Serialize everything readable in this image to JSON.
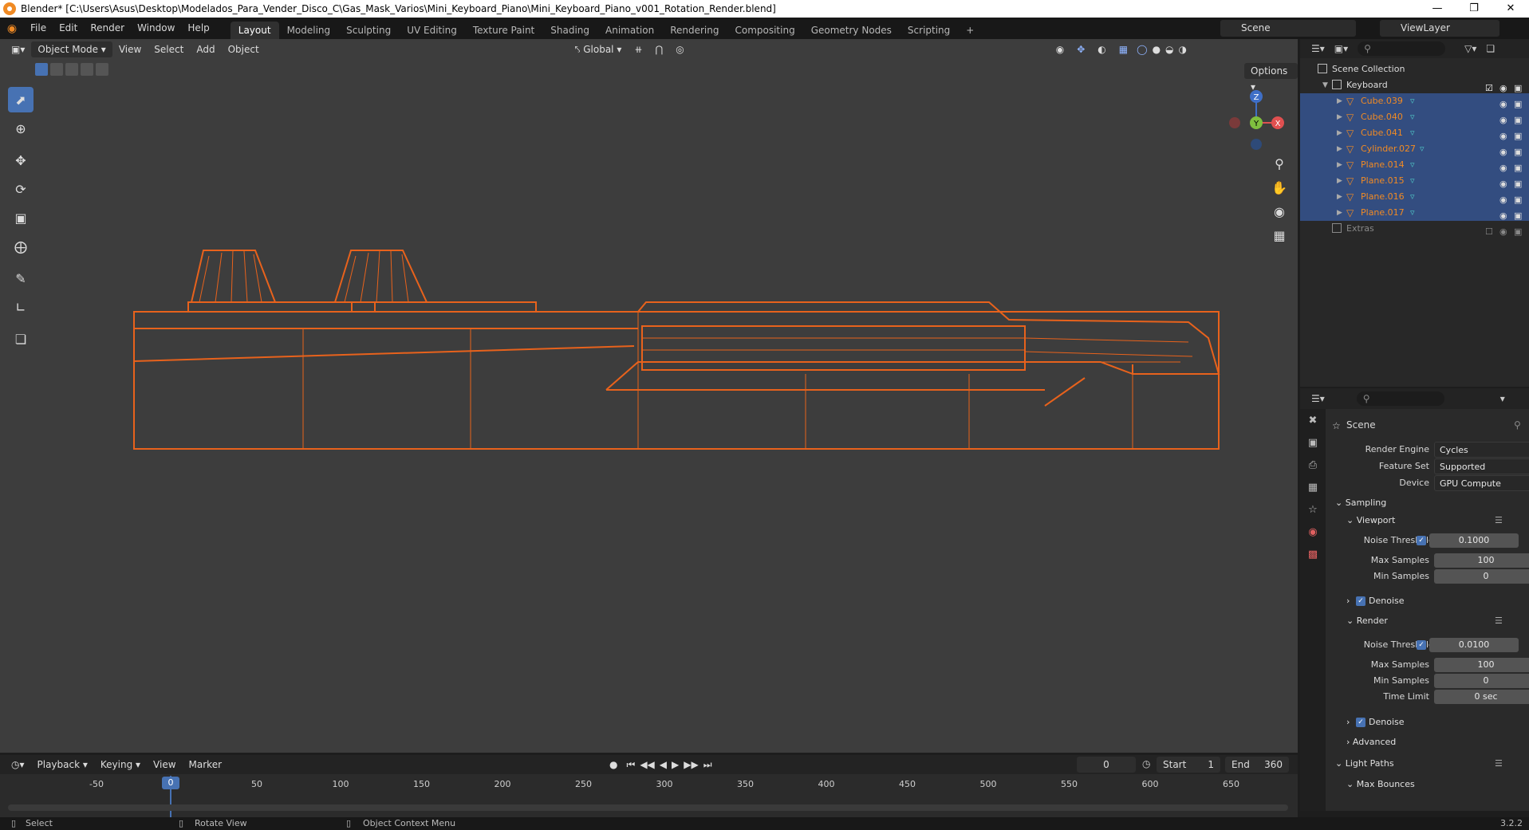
{
  "window": {
    "title": "Blender* [C:\\Users\\Asus\\Desktop\\Modelados_Para_Vender_Disco_C\\Gas_Mask_Varios\\Mini_Keyboard_Piano\\Mini_Keyboard_Piano_v001_Rotation_Render.blend]",
    "minimize": "—",
    "restore": "❐",
    "close": "✕"
  },
  "menubar": {
    "items": [
      "File",
      "Edit",
      "Render",
      "Window",
      "Help"
    ],
    "workspaces": [
      "Layout",
      "Modeling",
      "Sculpting",
      "UV Editing",
      "Texture Paint",
      "Shading",
      "Animation",
      "Rendering",
      "Compositing",
      "Geometry Nodes",
      "Scripting"
    ],
    "active_workspace": "Layout",
    "add_workspace": "+",
    "scene": "Scene",
    "view_layer": "ViewLayer"
  },
  "viewport": {
    "mode": "Object Mode",
    "menus": [
      "View",
      "Select",
      "Add",
      "Object"
    ],
    "transform_orientation": "Global",
    "options": "Options",
    "gizmo": {
      "z": "Z",
      "y": "Y",
      "x": "X"
    }
  },
  "outliner": {
    "root": "Scene Collection",
    "collection": "Keyboard",
    "objects": [
      "Cube.039",
      "Cube.040",
      "Cube.041",
      "Cylinder.027",
      "Plane.014",
      "Plane.015",
      "Plane.016",
      "Plane.017"
    ],
    "extras": "Extras",
    "selected_color": "#f08a24"
  },
  "properties": {
    "context": "Scene",
    "render_engine_label": "Render Engine",
    "render_engine": "Cycles",
    "feature_set_label": "Feature Set",
    "feature_set": "Supported",
    "device_label": "Device",
    "device": "GPU Compute",
    "sampling": "Sampling",
    "viewport": {
      "header": "Viewport",
      "noise_threshold_label": "Noise Threshold",
      "noise_threshold": "0.1000",
      "max_samples_label": "Max Samples",
      "max_samples": "100",
      "min_samples_label": "Min Samples",
      "min_samples": "0",
      "denoise": "Denoise"
    },
    "render": {
      "header": "Render",
      "noise_threshold_label": "Noise Threshold",
      "noise_threshold": "0.0100",
      "max_samples_label": "Max Samples",
      "max_samples": "100",
      "min_samples_label": "Min Samples",
      "min_samples": "0",
      "time_limit_label": "Time Limit",
      "time_limit": "0 sec",
      "denoise": "Denoise"
    },
    "advanced": "Advanced",
    "light_paths": "Light Paths",
    "max_bounces": "Max Bounces"
  },
  "timeline": {
    "menus": [
      "Playback",
      "Keying",
      "View",
      "Marker"
    ],
    "current_frame": "0",
    "start_label": "Start",
    "start": "1",
    "end_label": "End",
    "end": "360",
    "ticks": [
      "-50",
      "0",
      "50",
      "100",
      "150",
      "200",
      "250",
      "300",
      "350",
      "400",
      "450",
      "500",
      "550",
      "600",
      "650"
    ]
  },
  "statusbar": {
    "select": "Select",
    "rotate": "Rotate View",
    "context_menu": "Object Context Menu",
    "version": "3.2.2"
  },
  "colors": {
    "accent": "#4772b3",
    "wire": "#e8621c",
    "viewport_bg": "#3d3d3d"
  }
}
